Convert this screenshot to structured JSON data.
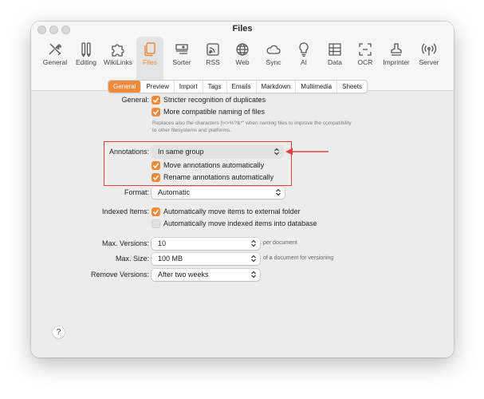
{
  "window": {
    "title": "Files"
  },
  "toolbar": {
    "items": [
      {
        "label": "General",
        "icon": "tools-icon"
      },
      {
        "label": "Editing",
        "icon": "pencils-icon"
      },
      {
        "label": "WikiLinks",
        "icon": "puzzle-icon"
      },
      {
        "label": "Files",
        "icon": "files-icon",
        "active": true
      },
      {
        "label": "Sorter",
        "icon": "sorter-icon"
      },
      {
        "label": "RSS",
        "icon": "rss-icon"
      },
      {
        "label": "Web",
        "icon": "globe-icon"
      },
      {
        "label": "Sync",
        "icon": "cloud-icon"
      },
      {
        "label": "AI",
        "icon": "lightbulb-icon"
      },
      {
        "label": "Data",
        "icon": "grid-icon"
      },
      {
        "label": "OCR",
        "icon": "ocr-icon"
      },
      {
        "label": "Imprinter",
        "icon": "stamp-icon"
      },
      {
        "label": "Server",
        "icon": "antenna-icon"
      }
    ]
  },
  "tabs": [
    "General",
    "Preview",
    "Import",
    "Tags",
    "Emails",
    "Markdown",
    "Multimedia",
    "Sheets"
  ],
  "active_tab": "General",
  "general": {
    "label": "General:",
    "opt1": "Stricter recognition of duplicates",
    "opt2": "More compatible naming of files",
    "hint1": "Replaces also the characters |\\<>%?&*\" when naming files to improve the compatibility",
    "hint2": "to other filesystems and platforms."
  },
  "annotations": {
    "label": "Annotations:",
    "value": "In same group",
    "opt1": "Move annotations automatically",
    "opt2": "Rename annotations automatically"
  },
  "format": {
    "label": "Format:",
    "value": "Automatic"
  },
  "indexed": {
    "label": "Indexed Items:",
    "opt1": "Automatically move items to external folder",
    "opt2": "Automatically move indexed items into database"
  },
  "max_versions": {
    "label": "Max. Versions:",
    "value": "10",
    "unit": "per document"
  },
  "max_size": {
    "label": "Max. Size:",
    "value": "100 MB",
    "unit": "of a document for versioning"
  },
  "remove_versions": {
    "label": "Remove Versions:",
    "value": "After two weeks"
  },
  "help": "?",
  "colors": {
    "accent": "#ee8a3a",
    "highlight": "#e0443c"
  }
}
